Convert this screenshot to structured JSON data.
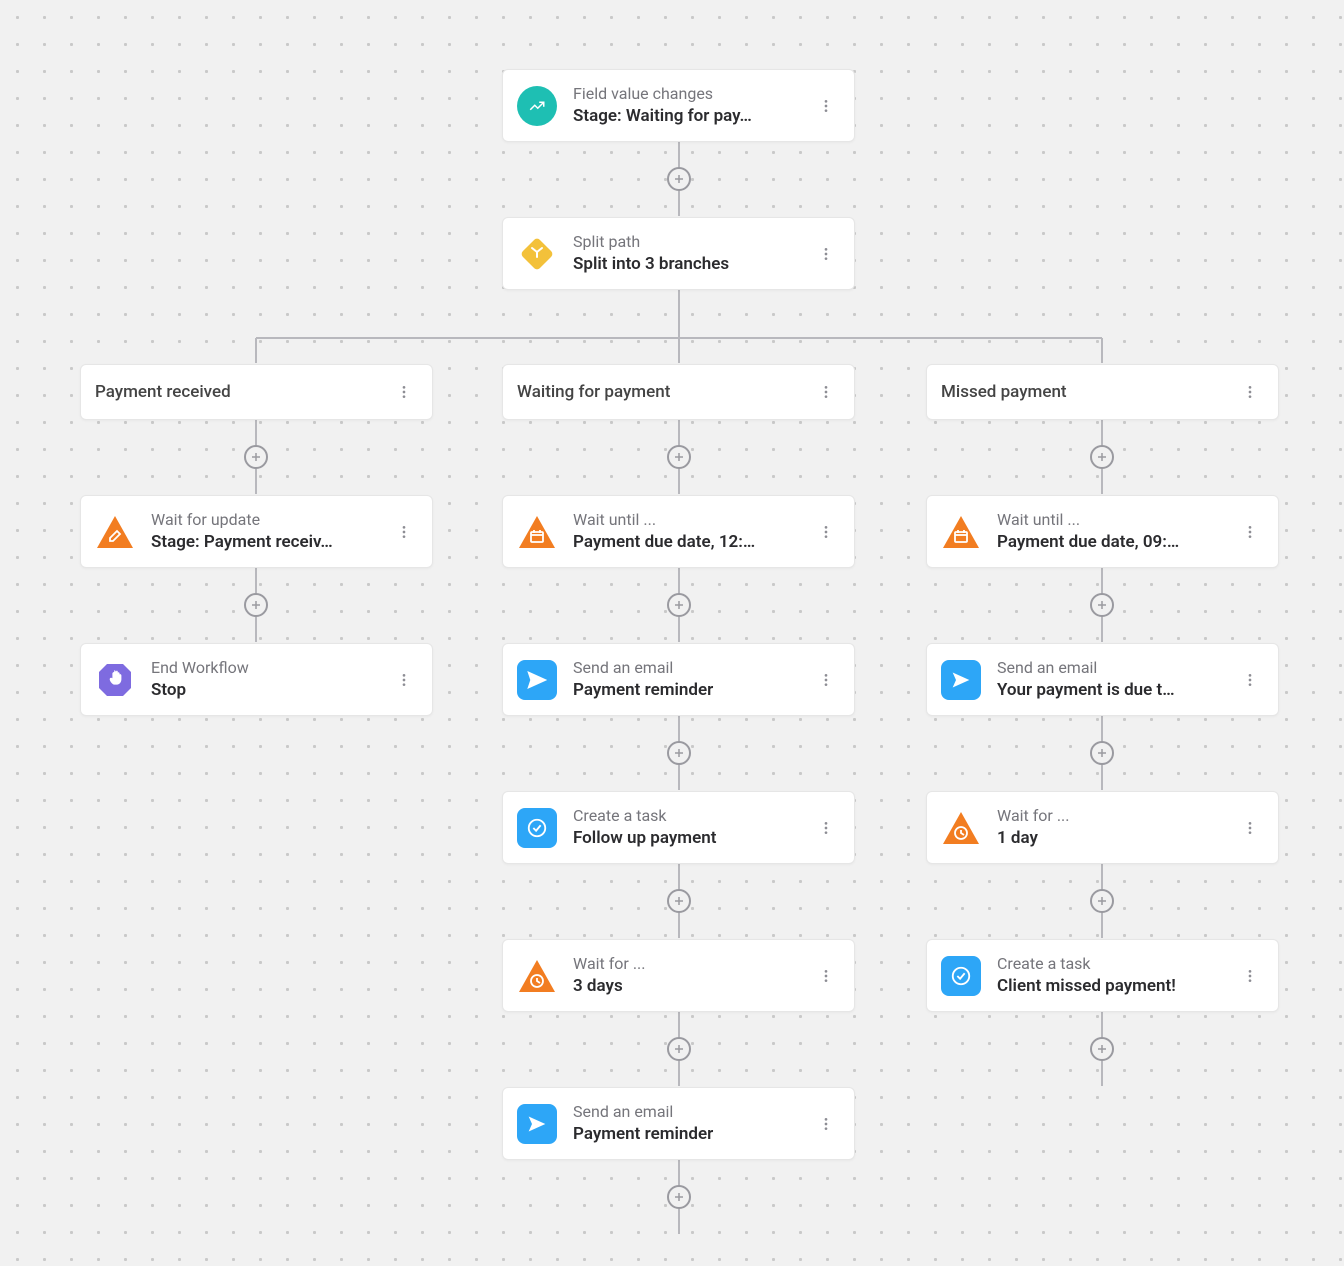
{
  "trigger": {
    "title": "Field value changes",
    "subtitle": "Stage: Waiting for pay…"
  },
  "split": {
    "title": "Split path",
    "subtitle": "Split into 3 branches"
  },
  "branches": [
    {
      "header": "Payment received",
      "nodes": [
        {
          "icon": "edit",
          "title": "Wait for update",
          "subtitle": "Stage: Payment receiv…"
        },
        {
          "icon": "stop",
          "title": "End Workflow",
          "subtitle": "Stop"
        }
      ]
    },
    {
      "header": "Waiting for payment",
      "nodes": [
        {
          "icon": "calendar",
          "title": "Wait until ...",
          "subtitle": "Payment due date, 12:…"
        },
        {
          "icon": "send",
          "title": "Send an email",
          "subtitle": "Payment reminder"
        },
        {
          "icon": "task",
          "title": "Create a task",
          "subtitle": "Follow up payment"
        },
        {
          "icon": "clock",
          "title": "Wait for ...",
          "subtitle": "3 days"
        },
        {
          "icon": "send",
          "title": "Send an email",
          "subtitle": "Payment reminder"
        }
      ]
    },
    {
      "header": "Missed payment",
      "nodes": [
        {
          "icon": "calendar",
          "title": "Wait until ...",
          "subtitle": "Payment due date, 09:…"
        },
        {
          "icon": "send",
          "title": "Send an email",
          "subtitle": "Your payment is due t…"
        },
        {
          "icon": "clock",
          "title": "Wait for ...",
          "subtitle": "1 day"
        },
        {
          "icon": "task",
          "title": "Create a task",
          "subtitle": "Client missed payment!"
        }
      ]
    }
  ]
}
